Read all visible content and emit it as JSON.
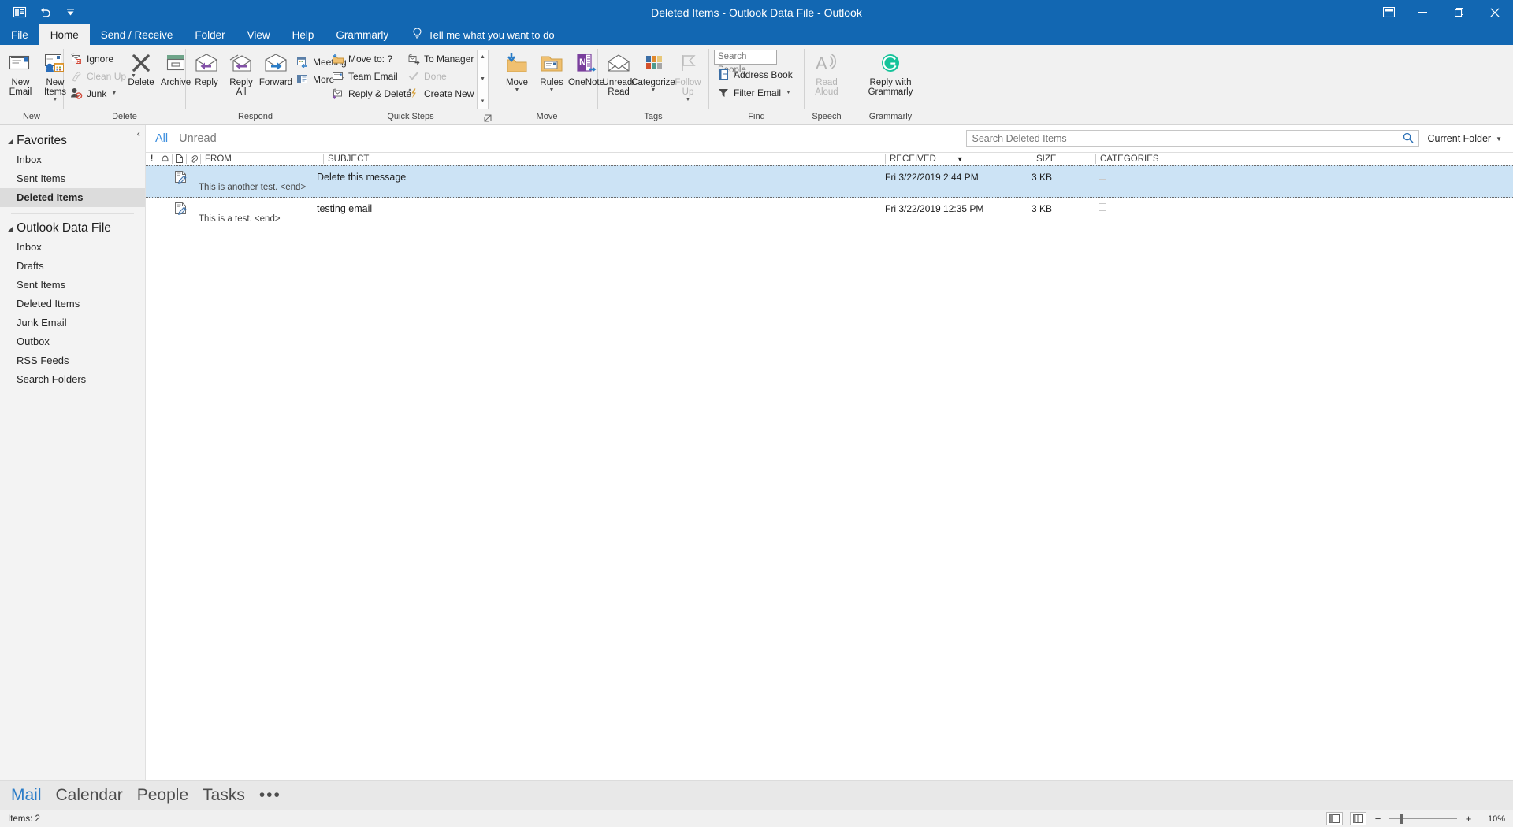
{
  "window": {
    "title": "Deleted Items - Outlook Data File  -  Outlook",
    "quick_access": [
      {
        "name": "outlook-logo-icon",
        "label": "Outlook"
      },
      {
        "name": "undo-icon",
        "label": "Undo"
      },
      {
        "name": "customize-quick-access-icon",
        "label": "Customize Quick Access Toolbar"
      }
    ],
    "controls": [
      {
        "name": "ribbon-display-options-button",
        "label": "Ribbon Display Options"
      },
      {
        "name": "minimize-button",
        "label": "Minimize"
      },
      {
        "name": "restore-button",
        "label": "Restore Down"
      },
      {
        "name": "close-button",
        "label": "Close"
      }
    ]
  },
  "tabs": [
    {
      "label": "File",
      "active": false
    },
    {
      "label": "Home",
      "active": true
    },
    {
      "label": "Send / Receive",
      "active": false
    },
    {
      "label": "Folder",
      "active": false
    },
    {
      "label": "View",
      "active": false
    },
    {
      "label": "Help",
      "active": false
    },
    {
      "label": "Grammarly",
      "active": false
    }
  ],
  "tell_me": {
    "placeholder": "Tell me what you want to do",
    "icon": "lightbulb-icon"
  },
  "ribbon": {
    "groups": [
      {
        "label": "New",
        "buttons": [
          {
            "label": "New\nEmail",
            "icon": "new-email-icon",
            "disabled": false,
            "caret": false
          },
          {
            "label": "New\nItems",
            "icon": "new-items-icon",
            "disabled": false,
            "caret": true
          }
        ]
      },
      {
        "label": "Delete",
        "small_buttons": [
          {
            "label": "Ignore",
            "icon": "ignore-icon",
            "disabled": false,
            "caret": false
          },
          {
            "label": "Clean Up",
            "icon": "clean-up-icon",
            "disabled": true,
            "caret": true
          },
          {
            "label": "Junk",
            "icon": "junk-icon",
            "disabled": false,
            "caret": true
          }
        ],
        "buttons": [
          {
            "label": "Delete",
            "icon": "delete-x-icon",
            "disabled": false,
            "caret": false
          },
          {
            "label": "Archive",
            "icon": "archive-icon",
            "disabled": false,
            "caret": false
          }
        ]
      },
      {
        "label": "Respond",
        "buttons": [
          {
            "label": "Reply",
            "icon": "reply-icon",
            "disabled": false,
            "caret": false
          },
          {
            "label": "Reply\nAll",
            "icon": "reply-all-icon",
            "disabled": false,
            "caret": false
          },
          {
            "label": "Forward",
            "icon": "forward-icon",
            "disabled": false,
            "caret": false
          }
        ],
        "small_buttons": [
          {
            "label": "Meeting",
            "icon": "meeting-icon",
            "disabled": false,
            "caret": false
          },
          {
            "label": "More",
            "icon": "more-respond-icon",
            "disabled": false,
            "caret": true
          }
        ]
      },
      {
        "label": "Quick Steps",
        "has_dialog_launcher": true,
        "quick_steps_col1": [
          {
            "label": "Move to: ?",
            "icon": "move-to-folder-icon",
            "disabled": false
          },
          {
            "label": "Team Email",
            "icon": "team-email-icon",
            "disabled": false
          },
          {
            "label": "Reply & Delete",
            "icon": "reply-delete-icon",
            "disabled": false
          }
        ],
        "quick_steps_col2": [
          {
            "label": "To Manager",
            "icon": "to-manager-icon",
            "disabled": false
          },
          {
            "label": "Done",
            "icon": "done-check-icon",
            "disabled": true
          },
          {
            "label": "Create New",
            "icon": "create-new-icon",
            "disabled": false
          }
        ]
      },
      {
        "label": "Move",
        "buttons": [
          {
            "label": "Move",
            "icon": "move-folder-icon",
            "disabled": false,
            "caret": true
          },
          {
            "label": "Rules",
            "icon": "rules-icon",
            "disabled": false,
            "caret": true
          },
          {
            "label": "OneNote",
            "icon": "onenote-icon",
            "disabled": false,
            "caret": false
          }
        ]
      },
      {
        "label": "Tags",
        "buttons": [
          {
            "label": "Unread/\nRead",
            "icon": "unread-read-icon",
            "disabled": false,
            "caret": false
          },
          {
            "label": "Categorize",
            "icon": "categorize-icon",
            "disabled": false,
            "caret": true
          },
          {
            "label": "Follow\nUp",
            "icon": "follow-up-flag-icon",
            "disabled": true,
            "caret": true
          }
        ]
      },
      {
        "label": "Find",
        "search_people_placeholder": "Search People",
        "small_buttons": [
          {
            "label": "Address Book",
            "icon": "address-book-icon",
            "disabled": false,
            "caret": false
          },
          {
            "label": "Filter Email",
            "icon": "filter-email-icon",
            "disabled": false,
            "caret": true
          }
        ]
      },
      {
        "label": "Speech",
        "buttons": [
          {
            "label": "Read\nAloud",
            "icon": "read-aloud-icon",
            "disabled": true,
            "caret": false
          }
        ]
      },
      {
        "label": "Grammarly",
        "buttons": [
          {
            "label": "Reply with\nGrammarly",
            "icon": "grammarly-icon",
            "disabled": false,
            "caret": false
          }
        ]
      }
    ]
  },
  "sidebar": {
    "collapse_icon": "collapse-pane-icon",
    "sections": [
      {
        "title": "Favorites",
        "items": [
          {
            "label": "Inbox",
            "selected": false
          },
          {
            "label": "Sent Items",
            "selected": false
          },
          {
            "label": "Deleted Items",
            "selected": true
          }
        ]
      },
      {
        "title": "Outlook Data File",
        "items": [
          {
            "label": "Inbox",
            "selected": false
          },
          {
            "label": "Drafts",
            "selected": false
          },
          {
            "label": "Sent Items",
            "selected": false
          },
          {
            "label": "Deleted Items",
            "selected": false
          },
          {
            "label": "Junk Email",
            "selected": false
          },
          {
            "label": "Outbox",
            "selected": false
          },
          {
            "label": "RSS Feeds",
            "selected": false
          },
          {
            "label": "Search Folders",
            "selected": false
          }
        ]
      }
    ]
  },
  "message_list": {
    "filters": [
      {
        "label": "All",
        "active": true
      },
      {
        "label": "Unread",
        "active": false
      }
    ],
    "search": {
      "placeholder": "Search Deleted Items",
      "value": "",
      "icon": "search-icon"
    },
    "scope": {
      "label": "Current Folder",
      "icon": "chevron-down-icon"
    },
    "columns": [
      {
        "label": "!",
        "name": "importance"
      },
      {
        "label": "",
        "name": "reminder"
      },
      {
        "label": "",
        "name": "has-attachment-doc"
      },
      {
        "label": "",
        "name": "attachment-clip"
      },
      {
        "label": "FROM",
        "name": "from"
      },
      {
        "label": "SUBJECT",
        "name": "subject"
      },
      {
        "label": "RECEIVED",
        "name": "received",
        "sorted": true,
        "sort_dir": "desc"
      },
      {
        "label": "SIZE",
        "name": "size"
      },
      {
        "label": "CATEGORIES",
        "name": "categories"
      }
    ],
    "rows": [
      {
        "from": "",
        "subject": "Delete this message",
        "preview": "This is another test. <end>",
        "received": "Fri 3/22/2019 2:44 PM",
        "size": "3 KB",
        "selected": true,
        "icon": "draft-message-icon"
      },
      {
        "from": "",
        "subject": "testing email",
        "preview": "This is a test. <end>",
        "received": "Fri 3/22/2019 12:35 PM",
        "size": "3 KB",
        "selected": false,
        "icon": "draft-message-icon"
      }
    ]
  },
  "nav": {
    "items": [
      {
        "label": "Mail",
        "active": true
      },
      {
        "label": "Calendar",
        "active": false
      },
      {
        "label": "People",
        "active": false
      },
      {
        "label": "Tasks",
        "active": false
      }
    ],
    "overflow": "•••"
  },
  "status": {
    "items_count": "Items: 2",
    "views": [
      {
        "name": "normal-view-button",
        "label": "Normal"
      },
      {
        "name": "reading-view-button",
        "label": "Reading View"
      }
    ],
    "zoom": {
      "minus": "−",
      "plus": "+",
      "percent": "10%"
    }
  },
  "colors": {
    "accent": "#1267b2",
    "selection": "#cce3f5",
    "link": "#3a8dde",
    "grammarly_green": "#15c39a"
  }
}
